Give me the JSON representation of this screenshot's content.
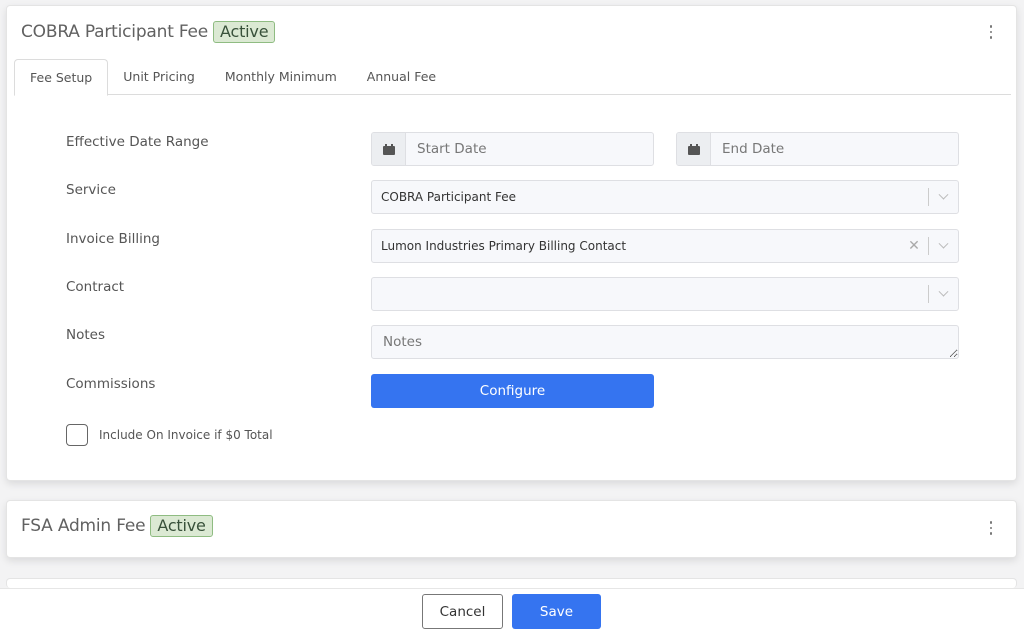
{
  "cards": [
    {
      "title": "COBRA Participant Fee",
      "status": "Active",
      "menu_icon": "kebab-vertical-icon",
      "tabs": [
        {
          "label": "Fee Setup",
          "active": true
        },
        {
          "label": "Unit Pricing",
          "active": false
        },
        {
          "label": "Monthly Minimum",
          "active": false
        },
        {
          "label": "Annual Fee",
          "active": false
        }
      ],
      "form": {
        "effective_date_range": {
          "label": "Effective Date Range",
          "start_placeholder": "Start Date",
          "start_value": "",
          "end_placeholder": "End Date",
          "end_value": "",
          "icon": "calendar-icon"
        },
        "service": {
          "label": "Service",
          "value": "COBRA Participant Fee"
        },
        "invoice_billing": {
          "label": "Invoice Billing",
          "value": "Lumon Industries Primary Billing Contact",
          "clearable": true
        },
        "contract": {
          "label": "Contract",
          "value": ""
        },
        "notes": {
          "label": "Notes",
          "placeholder": "Notes",
          "value": ""
        },
        "commissions": {
          "label": "Commissions",
          "button_label": "Configure"
        },
        "include_zero_total": {
          "label": "Include On Invoice if $0 Total",
          "checked": false
        }
      }
    },
    {
      "title": "FSA Admin Fee",
      "status": "Active",
      "menu_icon": "kebab-vertical-icon"
    }
  ],
  "footer": {
    "cancel_label": "Cancel",
    "save_label": "Save"
  },
  "colors": {
    "primary": "#3574f0",
    "badge_bg": "#dbe9d3",
    "badge_border": "#8fbc82"
  }
}
